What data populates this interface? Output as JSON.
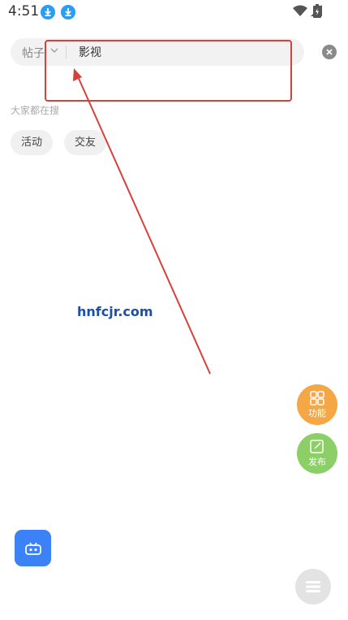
{
  "status_bar": {
    "time": "4:51"
  },
  "search": {
    "type_label": "帖子",
    "query": "影视"
  },
  "hot": {
    "label": "大家都在搜",
    "tags": [
      "活动",
      "交友"
    ]
  },
  "watermark": "hnfcjr.com",
  "fabs": {
    "function_label": "功能",
    "post_label": "发布"
  },
  "colors": {
    "annotation": "#d9403a",
    "function_fab": "#f5a746",
    "post_fab": "#8ccf66",
    "bot_button": "#3b82f6",
    "download_badge": "#2a9df4"
  }
}
